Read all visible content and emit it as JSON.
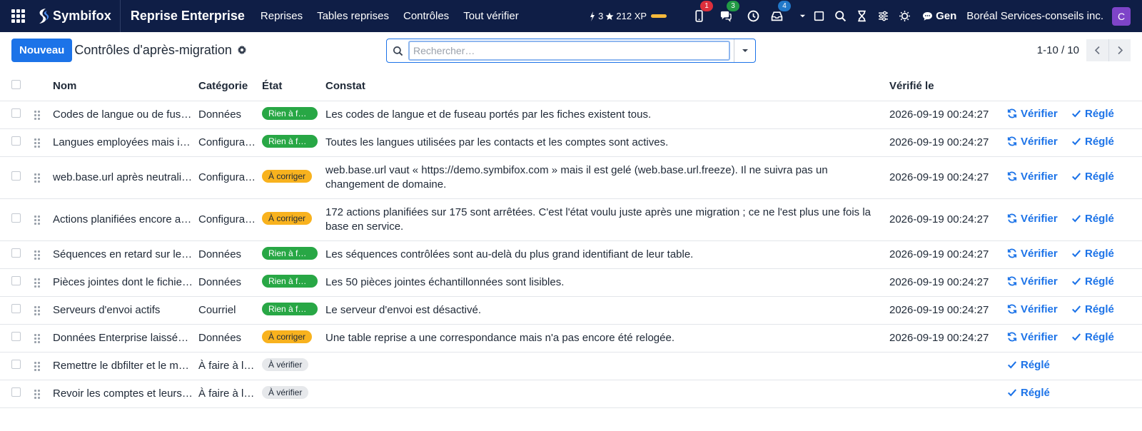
{
  "navbar": {
    "brand": "Symbifox",
    "app_title": "Reprise Enterprise",
    "menu": [
      "Reprises",
      "Tables reprises",
      "Contrôles",
      "Tout vérifier"
    ],
    "gamification": {
      "badge_count": "3",
      "xp": "212 XP"
    },
    "badges": {
      "activity": "1",
      "discuss": "3",
      "notifications": "4"
    },
    "chat_label": "Gen",
    "company": "Boréal Services-conseils inc.",
    "user_initial": "C",
    "colors": {
      "background": "#0f1e46",
      "avatar": "#7e44c8"
    }
  },
  "control_panel": {
    "new_button": "Nouveau",
    "title": "Contrôles d'après-migration",
    "search_placeholder": "Rechercher…",
    "pager": "1-10 / 10"
  },
  "table": {
    "headers": {
      "name": "Nom",
      "category": "Catégorie",
      "state": "État",
      "finding": "Constat",
      "checked_on": "Vérifié le"
    },
    "action_labels": {
      "verify": "Vérifier",
      "resolved": "Réglé"
    },
    "rows": [
      {
        "name": "Codes de langue ou de fuseau",
        "category": "Données",
        "state": "Rien à faire",
        "state_color": "green",
        "finding": "Les codes de langue et de fuseau portés par les fiches existent tous.",
        "checked_on": "2026-09-19 00:24:27",
        "verify": true
      },
      {
        "name": "Langues employées mais inactives",
        "category": "Configuration",
        "state": "Rien à faire",
        "state_color": "green",
        "finding": "Toutes les langues utilisées par les contacts et les comptes sont actives.",
        "checked_on": "2026-09-19 00:24:27",
        "verify": true
      },
      {
        "name": "web.base.url après neutralisation",
        "category": "Configuration",
        "state": "À corriger",
        "state_color": "orange",
        "finding": "web.base.url vaut « https://demo.symbifox.com » mais il est gelé (web.base.url.freeze). Il ne suivra pas un changement de domaine.",
        "checked_on": "2026-09-19 00:24:27",
        "verify": true
      },
      {
        "name": "Actions planifiées encore arrêtées",
        "category": "Configuration",
        "state": "À corriger",
        "state_color": "orange",
        "finding": "172 actions planifiées sur 175 sont arrêtées. C'est l'état voulu juste après une migration ; ce ne l'est plus une fois la base en service.",
        "checked_on": "2026-09-19 00:24:27",
        "verify": true
      },
      {
        "name": "Séquences en retard sur leur table",
        "category": "Données",
        "state": "Rien à faire",
        "state_color": "green",
        "finding": "Les séquences contrôlées sont au-delà du plus grand identifiant de leur table.",
        "checked_on": "2026-09-19 00:24:27",
        "verify": true
      },
      {
        "name": "Pièces jointes dont le fichier manque",
        "category": "Données",
        "state": "Rien à faire",
        "state_color": "green",
        "finding": "Les 50 pièces jointes échantillonnées sont lisibles.",
        "checked_on": "2026-09-19 00:24:27",
        "verify": true
      },
      {
        "name": "Serveurs d'envoi actifs",
        "category": "Courriel",
        "state": "Rien à faire",
        "state_color": "green",
        "finding": "Le serveur d'envoi est désactivé.",
        "checked_on": "2026-09-19 00:24:27",
        "verify": true
      },
      {
        "name": "Données Enterprise laissées en place",
        "category": "Données",
        "state": "À corriger",
        "state_color": "orange",
        "finding": "Une table reprise a une correspondance mais n'a pas encore été relogée.",
        "checked_on": "2026-09-19 00:24:27",
        "verify": true
      },
      {
        "name": "Remettre le dbfilter et le mot de passe",
        "category": "À faire à la main",
        "state": "À vérifier",
        "state_color": "grey",
        "finding": "",
        "checked_on": "",
        "verify": false
      },
      {
        "name": "Revoir les comptes et leurs accès",
        "category": "À faire à la main",
        "state": "À vérifier",
        "state_color": "grey",
        "finding": "",
        "checked_on": "",
        "verify": false
      }
    ]
  }
}
